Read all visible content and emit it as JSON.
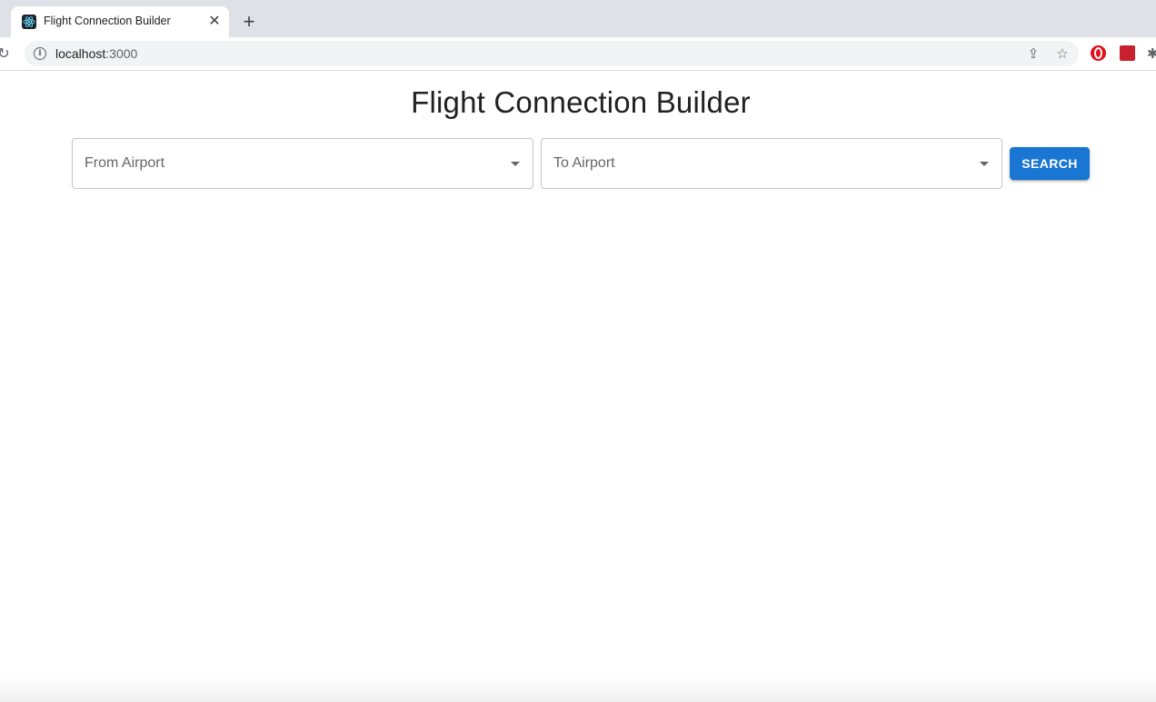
{
  "browser": {
    "tab_title": "Flight Connection Builder",
    "close_glyph": "✕",
    "new_tab_glyph": "+",
    "reload_glyph": "↻",
    "info_glyph": "i",
    "url_host": "localhost",
    "url_port": ":3000",
    "share_glyph": "⇪",
    "star_glyph": "☆",
    "extension_glyph": "✱"
  },
  "page": {
    "title": "Flight Connection Builder",
    "from_airport_label": "From Airport",
    "to_airport_label": "To Airport",
    "search_label": "SEARCH"
  },
  "colors": {
    "accent": "#1976d2",
    "tabstrip": "#dee1e6"
  }
}
